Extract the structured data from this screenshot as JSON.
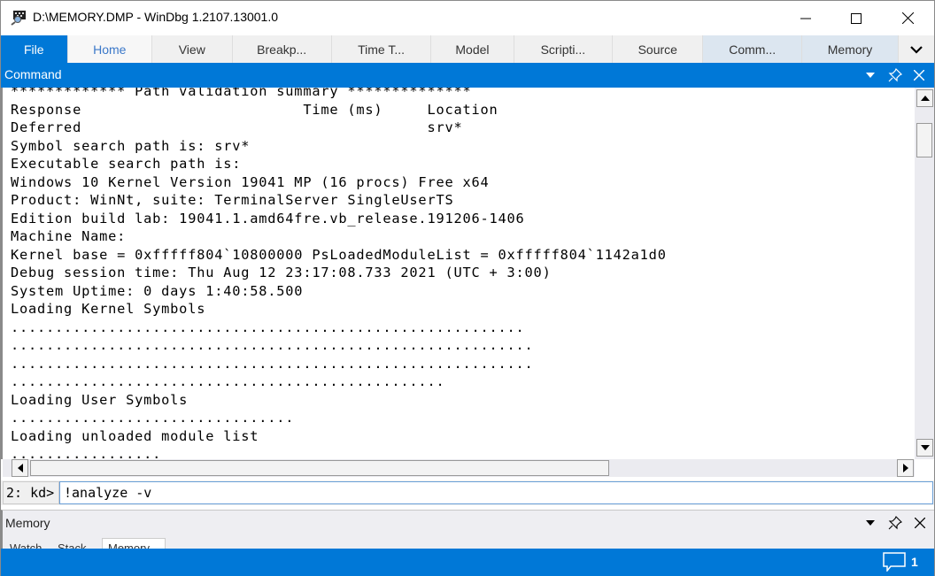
{
  "window": {
    "title": "D:\\MEMORY.DMP - WinDbg 1.2107.13001.0",
    "app_icon": "windbg-icon",
    "controls": [
      "minimize-icon",
      "maximize-icon",
      "close-icon"
    ]
  },
  "ribbon": {
    "tabs": [
      {
        "label": "File"
      },
      {
        "label": "Home"
      },
      {
        "label": "View"
      },
      {
        "label": "Breakp..."
      },
      {
        "label": "Time T..."
      },
      {
        "label": "Model"
      },
      {
        "label": "Scripti..."
      },
      {
        "label": "Source"
      },
      {
        "label": "Comm..."
      },
      {
        "label": "Memory"
      }
    ],
    "overflow_icon": "chevron-down-icon"
  },
  "command_pane": {
    "title": "Command",
    "output_lines": [
      "************* Path validation summary **************",
      "Response                         Time (ms)     Location",
      "Deferred                                       srv*",
      "Symbol search path is: srv*",
      "Executable search path is:",
      "Windows 10 Kernel Version 19041 MP (16 procs) Free x64",
      "Product: WinNt, suite: TerminalServer SingleUserTS",
      "Edition build lab: 19041.1.amd64fre.vb_release.191206-1406",
      "Machine Name:",
      "Kernel base = 0xfffff804`10800000 PsLoadedModuleList = 0xfffff804`1142a1d0",
      "Debug session time: Thu Aug 12 23:17:08.733 2021 (UTC + 3:00)",
      "System Uptime: 0 days 1:40:58.500",
      "Loading Kernel Symbols",
      "..........................................................",
      "...........................................................",
      "...........................................................",
      ".................................................",
      "Loading User Symbols",
      "................................",
      "Loading unloaded module list",
      "................."
    ],
    "prompt": "2: kd>",
    "input_value": "!analyze -v"
  },
  "memory_pane": {
    "title": "Memory",
    "tabs": [
      {
        "label": "Watch"
      },
      {
        "label": "Stack"
      },
      {
        "label": "Memory"
      }
    ]
  },
  "statusbar": {
    "notification_count": "1",
    "notification_icon": "chat-bubble-icon"
  },
  "colors": {
    "accent": "#0078d7",
    "tab_selected": "#dce6f0",
    "home_tab_text": "#3b78c9"
  }
}
